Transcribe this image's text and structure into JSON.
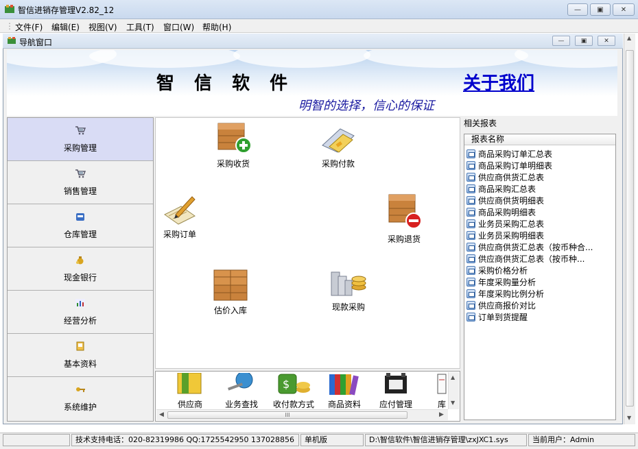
{
  "window": {
    "title": "智信进销存管理V2.82_12",
    "min_glyph": "▭",
    "max_glyph": "□",
    "close_glyph": "✕"
  },
  "menu": [
    "文件(F)",
    "编辑(E)",
    "视图(V)",
    "工具(T)",
    "窗口(W)",
    "帮助(H)"
  ],
  "child_window": {
    "title": "导航窗口"
  },
  "banner": {
    "brand": "智 信 软 件",
    "about_link": "关于我们",
    "slogan": "明智的选择，信心的保证"
  },
  "nav": {
    "items": [
      {
        "label": "采购管理",
        "icon": "cart-icon",
        "active": true
      },
      {
        "label": "销售管理",
        "icon": "cart-icon",
        "active": false
      },
      {
        "label": "仓库管理",
        "icon": "warehouse-icon",
        "active": false
      },
      {
        "label": "现金银行",
        "icon": "money-bag-icon",
        "active": false
      },
      {
        "label": "经营分析",
        "icon": "chart-icon",
        "active": false
      },
      {
        "label": "基本资料",
        "icon": "book-icon",
        "active": false
      },
      {
        "label": "系统维护",
        "icon": "key-icon",
        "active": false
      }
    ]
  },
  "workspace": {
    "icons": [
      {
        "label": "采购收货",
        "icon": "crate-add-icon"
      },
      {
        "label": "采购付款",
        "icon": "payment-card-icon"
      },
      {
        "label": "采购订单",
        "icon": "order-pen-icon"
      },
      {
        "label": "采购退货",
        "icon": "crate-remove-icon"
      },
      {
        "label": "估价入库",
        "icon": "crates-stack-icon"
      },
      {
        "label": "现款采购",
        "icon": "cash-purchase-icon"
      }
    ]
  },
  "strip": {
    "items": [
      {
        "label": "供应商",
        "icon": "supplier-icon"
      },
      {
        "label": "业务查找",
        "icon": "search-globe-icon"
      },
      {
        "label": "收付款方式",
        "icon": "money-icon"
      },
      {
        "label": "商品资料",
        "icon": "books-icon"
      },
      {
        "label": "应付管理",
        "icon": "film-icon"
      },
      {
        "label": "库",
        "icon": "partial-icon"
      }
    ],
    "hscroll_grip": "III"
  },
  "reports": {
    "title": "相关报表",
    "column_header": "报表名称",
    "items": [
      "商品采购订单汇总表",
      "商品采购订单明细表",
      "供应商供货汇总表",
      "商品采购汇总表",
      "供应商供货明细表",
      "商品采购明细表",
      "业务员采购汇总表",
      "业务员采购明细表",
      "供应商供货汇总表（按币种合...",
      "供应商供货汇总表（按币种...",
      "采购价格分析",
      "年度采购量分析",
      "年度采购比例分析",
      "供应商报价对比",
      "订单到货提醒"
    ]
  },
  "status": {
    "support": "技术支持电话：020-82319986 QQ:1725542950 137028856",
    "mode": "单机版",
    "path": "D:\\智信软件\\智信进销存管理\\zxJXC1.sys",
    "user": "当前用户：Admin"
  }
}
